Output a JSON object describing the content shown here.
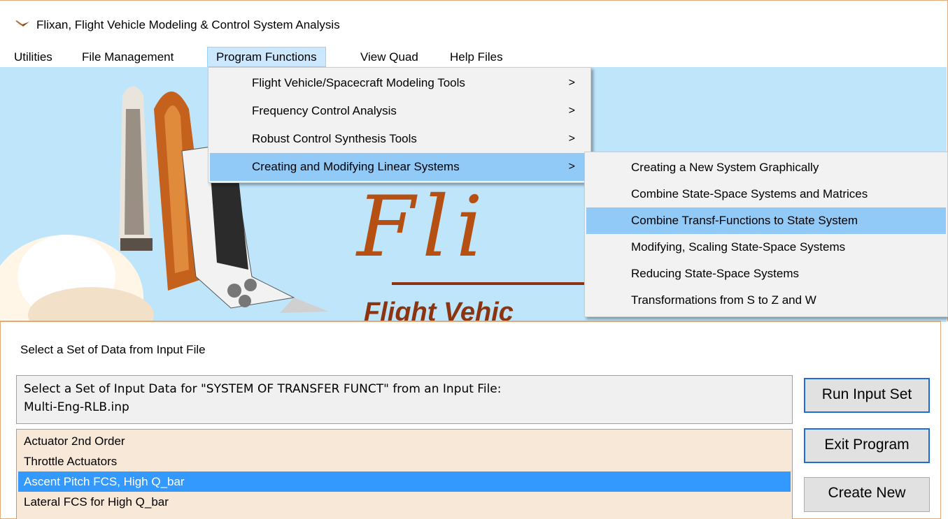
{
  "window": {
    "title": "Flixan, Flight Vehicle Modeling & Control System Analysis"
  },
  "menubar": {
    "items": [
      "Utilities",
      "File Management",
      "Program Functions",
      "View Quad",
      "Help Files"
    ]
  },
  "splash": {
    "logo_text": "Fli",
    "subtitle": "Flight Vehic"
  },
  "program_functions_menu": {
    "items": [
      {
        "label": "Flight Vehicle/Spacecraft Modeling Tools",
        "arrow": ">"
      },
      {
        "label": "Frequency Control Analysis",
        "arrow": ">"
      },
      {
        "label": "Robust Control Synthesis Tools",
        "arrow": ">"
      },
      {
        "label": "Creating and Modifying Linear Systems",
        "arrow": ">"
      }
    ]
  },
  "linear_systems_submenu": {
    "items": [
      "Creating a New System Graphically",
      "Combine State-Space Systems and Matrices",
      "Combine Transf-Functions to State System",
      "Modifying, Scaling State-Space Systems",
      "Reducing State-Space Systems",
      "Transformations from S to Z and W"
    ]
  },
  "dialog": {
    "title": "Select a Set of Data from Input File",
    "prompt_line1": "Select a Set of Input Data for \"SYSTEM OF TRANSFER FUNCT\" from an Input File:",
    "prompt_line2": "Multi-Eng-RLB.inp",
    "list_items": [
      "Actuator 2nd Order",
      "Throttle Actuators",
      "Ascent Pitch FCS, High Q_bar",
      "Lateral FCS for High Q_bar"
    ],
    "selected_item": "Ascent Pitch FCS, High Q_bar",
    "buttons": {
      "run": "Run Input Set",
      "exit": "Exit Program",
      "create": "Create New"
    }
  },
  "colors": {
    "splash_bg": "#bfe5fb",
    "menu_highlight": "#91c9f7",
    "list_bg": "#f7e8d8",
    "list_selected": "#3399ff",
    "logo_brown": "#b54f12"
  }
}
